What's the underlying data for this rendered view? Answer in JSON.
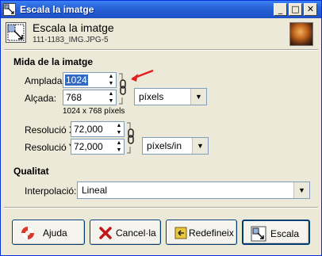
{
  "window": {
    "title": "Escala la imatge",
    "controls": {
      "minimize": "_",
      "maximize": "□",
      "close": "✕"
    }
  },
  "header": {
    "title": "Escala la imatge",
    "subtitle": "111-1183_IMG.JPG-5"
  },
  "image_size": {
    "section_label": "Mida de la imatge",
    "width_label": "Amplada:",
    "width_value": "1024",
    "height_label": "Alçada:",
    "height_value": "768",
    "size_info": "1024 x 768 píxels",
    "unit_value": "píxels"
  },
  "resolution": {
    "x_label": "Resolució X:",
    "x_value": "72,000",
    "y_label": "Resolució Y:",
    "y_value": "72,000",
    "unit_value": "píxels/in"
  },
  "quality": {
    "section_label": "Qualitat",
    "interpolation_label": "Interpolació:",
    "interpolation_value": "Lineal"
  },
  "buttons": {
    "help": "Ajuda",
    "cancel": "Cancel·la",
    "reset": "Redefineix",
    "scale": "Escala"
  },
  "colors": {
    "titlebar": "#2864d8",
    "dialog_bg": "#ece9d8",
    "annotation_arrow": "#e02020",
    "selection": "#316ac5"
  }
}
